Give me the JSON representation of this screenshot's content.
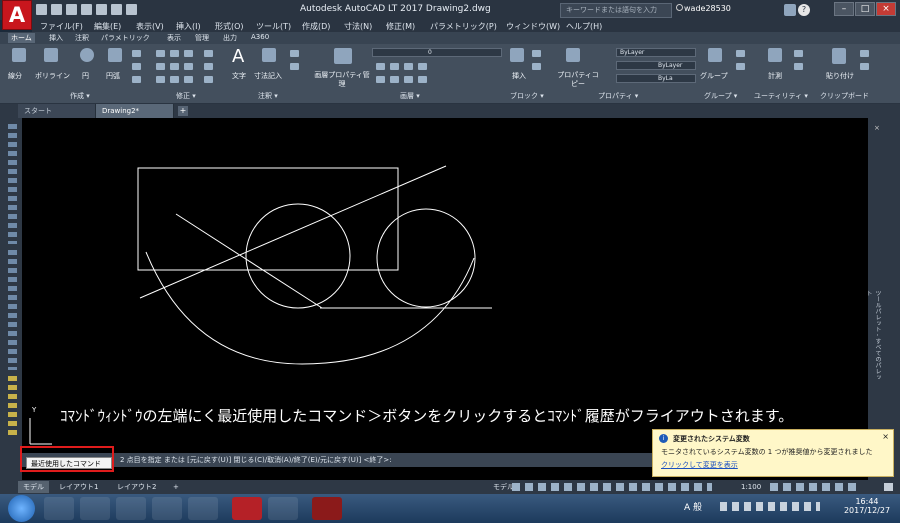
{
  "app": {
    "title": "Autodesk AutoCAD LT 2017      Drawing2.dwg",
    "search_placeholder": "キーワードまたは語句を入力",
    "user": "wade28530",
    "logo": "A"
  },
  "menu": [
    "ファイル(F)",
    "編集(E)",
    "表示(V)",
    "挿入(I)",
    "形式(O)",
    "ツール(T)",
    "作成(D)",
    "寸法(N)",
    "修正(M)",
    "パラメトリック(P)",
    "ウィンドウ(W)",
    "ヘルプ(H)"
  ],
  "ribbon_tabs": [
    "ホーム",
    "挿入",
    "注釈",
    "パラメトリック",
    "表示",
    "管理",
    "出力",
    "A360"
  ],
  "ribbon": {
    "draw_tools": [
      "線分",
      "ポリライン",
      "円",
      "円弧"
    ],
    "text_tools": [
      "文字",
      "寸法記入"
    ],
    "layer_props": "画層プロパティ管理",
    "layer_value": "0",
    "insert": "挿入",
    "properties": "プロパティコピー",
    "bylayer": "ByLayer",
    "bylayer2": "ByLayer",
    "bylayer3": "ByLa",
    "group": "グループ",
    "measure": "計測",
    "paste": "貼り付け",
    "panels": [
      "作成 ▾",
      "修正 ▾",
      "注釈 ▾",
      "画層 ▾",
      "ブロック ▾",
      "プロパティ ▾",
      "グループ ▾",
      "ユーティリティ ▾",
      "クリップボード"
    ]
  },
  "doc_tabs": [
    "スタート",
    "Drawing2*"
  ],
  "caption": "ｺﾏﾝﾄﾞｳｨﾝﾄﾞｳの左端にく最近使用したコマンド＞ボタンをクリックするとｺﾏﾝﾄﾞ履歴がフライアウトされます。",
  "command": {
    "text": "2 点目を指定 または [元に戻す(U)] 閉じる(C)/取消(A)/終了(E)/元に戻す(U)] <終了>:",
    "tooltip": "最近使用したコマンド"
  },
  "notification": {
    "title": "変更されたシステム変数",
    "body": "モニタされているシステム変数の 1 つが推奨値から変更されました",
    "link": "クリックして変更を表示"
  },
  "layout_tabs": [
    "モデル",
    "レイアウト1",
    "レイアウト2"
  ],
  "status": {
    "model": "モデル",
    "scale": "1:100"
  },
  "clock": {
    "time": "16:44",
    "date": "2017/12/27"
  },
  "taskbar_label": "A 般",
  "right_palette": "ツールパレット - すべてのパレット"
}
